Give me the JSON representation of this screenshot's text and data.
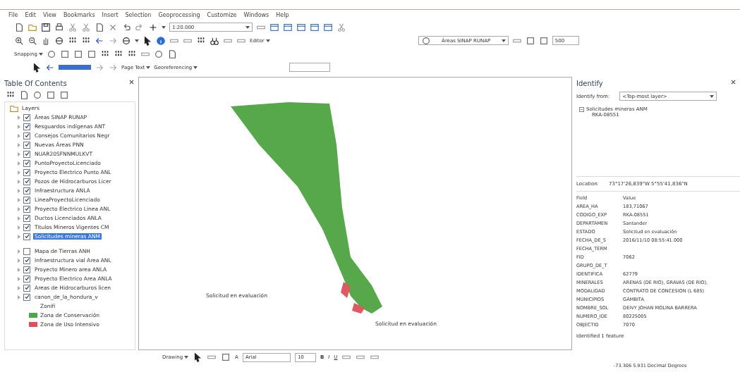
{
  "menu": [
    "File",
    "Edit",
    "View",
    "Bookmarks",
    "Insert",
    "Selection",
    "Geoprocessing",
    "Customize",
    "Windows",
    "Help"
  ],
  "toolbars": {
    "scale": "1:20.000",
    "editor": "Editor",
    "layer_select": "Áreas SINAP RUNAP",
    "tolerance": "500",
    "snapping": "Snapping",
    "page_text": "Page Text",
    "georeferencing": "Georeferencing"
  },
  "toc": {
    "title": "Table Of Contents",
    "group": "Layers",
    "layers": [
      {
        "label": "Áreas SINAP RUNAP",
        "checked": true,
        "selected": false
      },
      {
        "label": "Resguardos indígenas ANT",
        "checked": true,
        "selected": false
      },
      {
        "label": "Consejos Comunitarios Negr",
        "checked": true,
        "selected": false
      },
      {
        "label": "Nuevas Áreas PNN",
        "checked": true,
        "selected": false
      },
      {
        "label": "NUAR20SFNNMULKVT",
        "checked": true,
        "selected": false
      },
      {
        "label": "PuntoProyectoLicenciado",
        "checked": true,
        "selected": false
      },
      {
        "label": "Proyecto Electrico Punto ANL",
        "checked": true,
        "selected": false
      },
      {
        "label": "Pozos de Hidrocarburos Licer",
        "checked": true,
        "selected": false
      },
      {
        "label": "Infraestructura ANLA",
        "checked": true,
        "selected": false
      },
      {
        "label": "LineaProyectoLicenciado",
        "checked": true,
        "selected": false
      },
      {
        "label": "Proyecto Electrico Linea ANL",
        "checked": true,
        "selected": false
      },
      {
        "label": "Ductos Licenciados ANLA",
        "checked": true,
        "selected": false
      },
      {
        "label": "Titulos Mineros Vigentes CM",
        "checked": true,
        "selected": false
      },
      {
        "label": "Solicitudes mineras ANM",
        "checked": true,
        "selected": true
      }
    ],
    "layers2": [
      {
        "label": "Mapa de Tierras ANH",
        "checked": false,
        "selected": false
      },
      {
        "label": "Infraestructura vial Area ANL",
        "checked": true,
        "selected": false
      },
      {
        "label": "Proyecto Minero area ANLA",
        "checked": true,
        "selected": false
      },
      {
        "label": "Proyecto Electrico Area ANLA",
        "checked": true,
        "selected": false
      },
      {
        "label": "Areas de Hidrocarburos licen",
        "checked": true,
        "selected": false
      },
      {
        "label": "canon_de_la_hondura_v",
        "checked": true,
        "selected": false
      }
    ],
    "legend_heading": "Zonifi",
    "legend": [
      {
        "label": "Zona de Conservación",
        "color": "#4aa84a"
      },
      {
        "label": "Zona de Uso Intensivo",
        "color": "#e0505a"
      }
    ]
  },
  "map": {
    "labels": [
      "Solicitud en evaluación",
      "Solicitud en evaluación"
    ]
  },
  "drawing_toolbar": {
    "drawing": "Drawing",
    "font": "Arial",
    "size": "10",
    "bold": "B",
    "italic": "I",
    "underline": "U",
    "font_color": "A"
  },
  "identify": {
    "title": "Identify",
    "from_label": "Identify from:",
    "from_value": "<Top-most layer>",
    "layer": "Solicitudes mineras ANM",
    "feature": "RKA-08551",
    "location_label": "Location:",
    "location": "73°17'26,839\"W  5°55'41,836\"N",
    "columns": [
      "Field",
      "Value"
    ],
    "rows": [
      [
        "AREA_HA",
        "183,71067"
      ],
      [
        "CODIGO_EXP",
        "RKA-08551"
      ],
      [
        "DEPARTAMEN",
        "Santander"
      ],
      [
        "ESTADO",
        "Solicitud en evaluación"
      ],
      [
        "FECHA_DE_S",
        "2016/11/10 08:55:41.000"
      ],
      [
        "FECHA_TERM",
        ""
      ],
      [
        "FID",
        "7062"
      ],
      [
        "GRUPO_DE_T",
        ""
      ],
      [
        "IDENTIFICA",
        "62779"
      ],
      [
        "MINERALES",
        "ARENAS (DE RIO), GRAVAS (DE RIO),"
      ],
      [
        "MODALIDAD",
        "CONTRATO DE CONCESION (L 685)"
      ],
      [
        "MUNICIPIOS",
        "GÁMBITA"
      ],
      [
        "NOMBRE_SOL",
        "DEIVY JOHAN MOLINA BARRERA"
      ],
      [
        "NUMERO_IDE",
        "80225005"
      ],
      [
        "OBJECTID",
        "7070"
      ]
    ],
    "status": "Identified 1 feature"
  },
  "status_bar": "-73.306  5.931 Decimal Degrees"
}
